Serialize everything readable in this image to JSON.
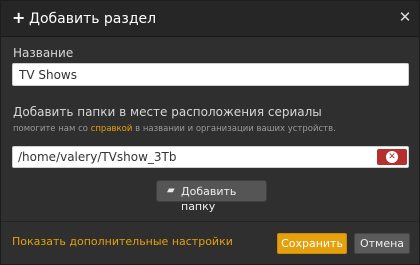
{
  "dialog": {
    "title": "Добавить раздел",
    "plus_glyph": "+",
    "close_glyph": "✕",
    "close_icon": "close-icon",
    "plus_icon": "plus-icon"
  },
  "name_field": {
    "label": "Название",
    "value": "TV Shows"
  },
  "folders": {
    "label": "Добавить папки в месте расположения сериалы",
    "help_prefix": "помогите нам со",
    "help_link": "справкой",
    "help_suffix": "в названии и организации ваших устройств.",
    "items": [
      {
        "path": "/home/valery/TVshow_3Tb",
        "remove_icon": "remove-icon",
        "remove_glyph": "✕"
      }
    ],
    "add_button_label": "Добавить папку",
    "add_button_icon": "folder-add-icon",
    "folder_glyph": "▰"
  },
  "footer": {
    "advanced_link": "Показать дополнительные настройки",
    "save_label": "Сохранить",
    "cancel_label": "Отмена"
  },
  "colors": {
    "background": "#2f2f2f",
    "header": "#262626",
    "accent": "#e5a00d",
    "remove_red": "#b5302c",
    "secondary_button": "#5b5b5b"
  }
}
